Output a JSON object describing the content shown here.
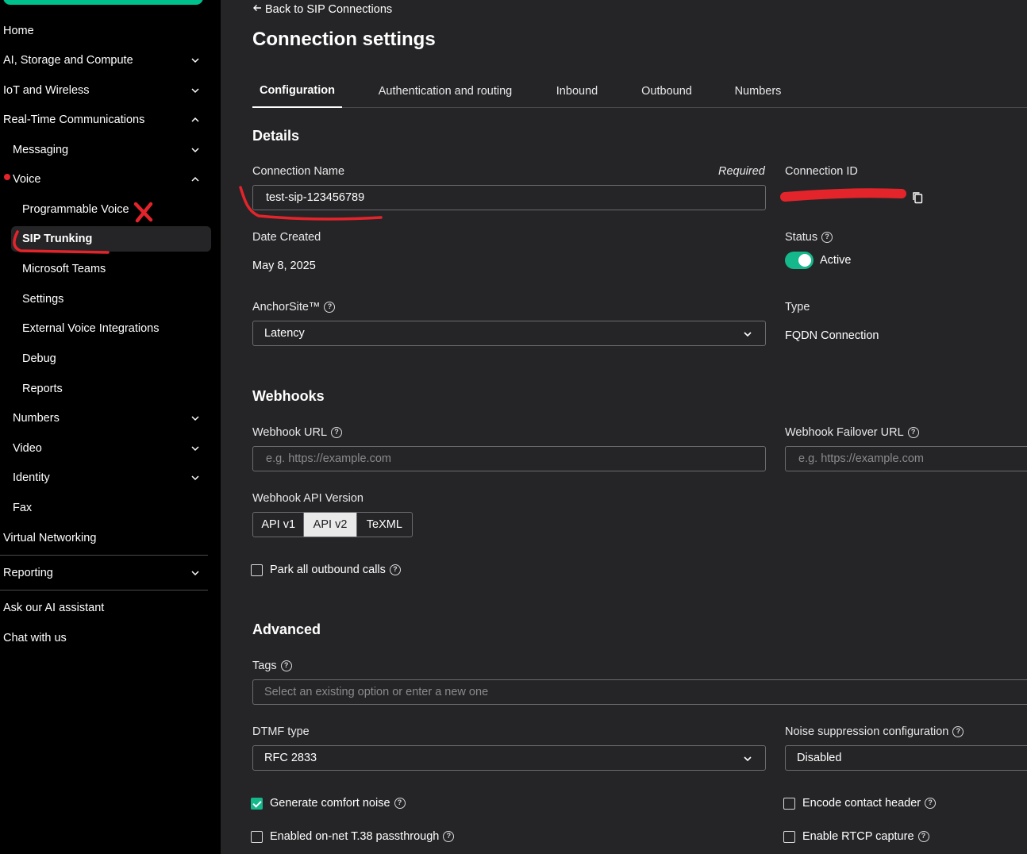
{
  "sidebar": {
    "items": [
      {
        "label": "Home"
      },
      {
        "label": "AI, Storage and Compute",
        "chevron": "down"
      },
      {
        "label": "IoT and Wireless",
        "chevron": "down"
      },
      {
        "label": "Real-Time Communications",
        "chevron": "up"
      },
      {
        "label": "Messaging",
        "chevron": "down"
      },
      {
        "label": "Voice",
        "chevron": "up"
      },
      {
        "label": "Programmable Voice"
      },
      {
        "label": "SIP Trunking",
        "active": true
      },
      {
        "label": "Microsoft Teams"
      },
      {
        "label": "Settings"
      },
      {
        "label": "External Voice Integrations"
      },
      {
        "label": "Debug"
      },
      {
        "label": "Reports"
      },
      {
        "label": "Numbers",
        "chevron": "down"
      },
      {
        "label": "Video",
        "chevron": "down"
      },
      {
        "label": "Identity",
        "chevron": "down"
      },
      {
        "label": "Fax"
      },
      {
        "label": "Virtual Networking"
      },
      {
        "label": "Reporting",
        "chevron": "down"
      },
      {
        "label": "Ask our AI assistant"
      },
      {
        "label": "Chat with us"
      }
    ]
  },
  "header": {
    "back_label": "Back to SIP Connections",
    "title": "Connection settings"
  },
  "tabs": [
    {
      "label": "Configuration",
      "active": true
    },
    {
      "label": "Authentication and routing"
    },
    {
      "label": "Inbound"
    },
    {
      "label": "Outbound"
    },
    {
      "label": "Numbers"
    }
  ],
  "details": {
    "heading": "Details",
    "connection_name_label": "Connection Name",
    "required_label": "Required",
    "connection_name_value": "test-sip-123456789",
    "connection_id_label": "Connection ID",
    "date_created_label": "Date Created",
    "date_created_value": "May 8, 2025",
    "status_label": "Status",
    "status_value": "Active",
    "anchorsite_label": "AnchorSite™",
    "anchorsite_value": "Latency",
    "type_label": "Type",
    "type_value": "FQDN Connection"
  },
  "webhooks": {
    "heading": "Webhooks",
    "url_label": "Webhook URL",
    "url_placeholder": "e.g. https://example.com",
    "failover_label": "Webhook Failover URL",
    "failover_placeholder": "e.g. https://example.com",
    "api_version_label": "Webhook API Version",
    "api_versions": [
      "API v1",
      "API v2",
      "TeXML"
    ],
    "api_version_selected": "API v2",
    "park_label": "Park all outbound calls",
    "park_checked": false
  },
  "advanced": {
    "heading": "Advanced",
    "tags_label": "Tags",
    "tags_placeholder": "Select an existing option or enter a new one",
    "dtmf_label": "DTMF type",
    "dtmf_value": "RFC 2833",
    "noise_label": "Noise suppression configuration",
    "noise_value": "Disabled",
    "comfort_label": "Generate comfort noise",
    "comfort_checked": true,
    "encode_label": "Encode contact header",
    "encode_checked": false,
    "t38_label": "Enabled on-net T.38 passthrough",
    "t38_checked": false,
    "rtcp_label": "Enable RTCP capture",
    "rtcp_checked": false
  },
  "colors": {
    "accent": "#14b88b",
    "annotation": "#e4242b",
    "background": "#252527",
    "sidebar": "#000000"
  }
}
